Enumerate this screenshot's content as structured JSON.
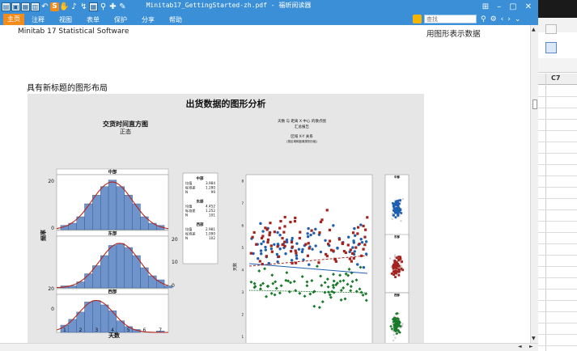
{
  "window": {
    "title": "Minitab17_GettingStarted-zh.pdf - 福昕阅读器"
  },
  "menu": {
    "items": [
      "主页",
      "注释",
      "视图",
      "表单",
      "保护",
      "分享",
      "帮助"
    ],
    "search_placeholder": "查找"
  },
  "document": {
    "header_left": "Minitab 17 Statistical Software",
    "header_right": "用图形表示数据",
    "section_title": "具有新标题的图形布局"
  },
  "figure": {
    "title": "出货数据的图形分析",
    "hist": {
      "title": "交货时间直方图",
      "subtitle": "正态",
      "panel_labels": [
        "中部",
        "东部",
        "西部"
      ],
      "xlabel": "天数",
      "ylabel": "频率",
      "x_ticks": [
        "1",
        "2",
        "3",
        "4",
        "5",
        "6",
        "7"
      ],
      "left_ticks": [
        "20",
        "0",
        "20",
        "0"
      ],
      "right_ticks": [
        "20",
        "10",
        "0"
      ],
      "colors": {
        "bar": "#6f94cc",
        "curve": "#b3261e"
      }
    },
    "legend": {
      "groups": [
        {
          "name": "中部",
          "rows": [
            [
              "均值",
              "3.984"
            ],
            [
              "标准差",
              "1.280"
            ],
            [
              "N",
              "99"
            ]
          ]
        },
        {
          "name": "东部",
          "rows": [
            [
              "均值",
              "4.452"
            ],
            [
              "标准差",
              "1.252"
            ],
            [
              "N",
              "101"
            ]
          ]
        },
        {
          "name": "西部",
          "rows": [
            [
              "均值",
              "2.981"
            ],
            [
              "标准差",
              "1.090"
            ],
            [
              "N",
              "102"
            ]
          ]
        }
      ]
    },
    "scatter": {
      "title_line1": "天数 与 距离 X 中心 的散点图",
      "title_line2": "汇总报告",
      "subtitle_line1": "区域 X-Y 关系",
      "subtitle_line2": "(按区域和距离类别分组)",
      "ylabel": "天数",
      "y_ticks": [
        "8",
        "7",
        "6",
        "5",
        "4",
        "3",
        "2",
        "1",
        "0"
      ],
      "colors": {
        "blue": "#1f5fb0",
        "red": "#a4231d",
        "green": "#1a7a2a"
      }
    },
    "side_panels": {
      "labels": [
        "中部",
        "东部",
        "西部"
      ]
    }
  },
  "background_app": {
    "column_header": "C7"
  }
}
